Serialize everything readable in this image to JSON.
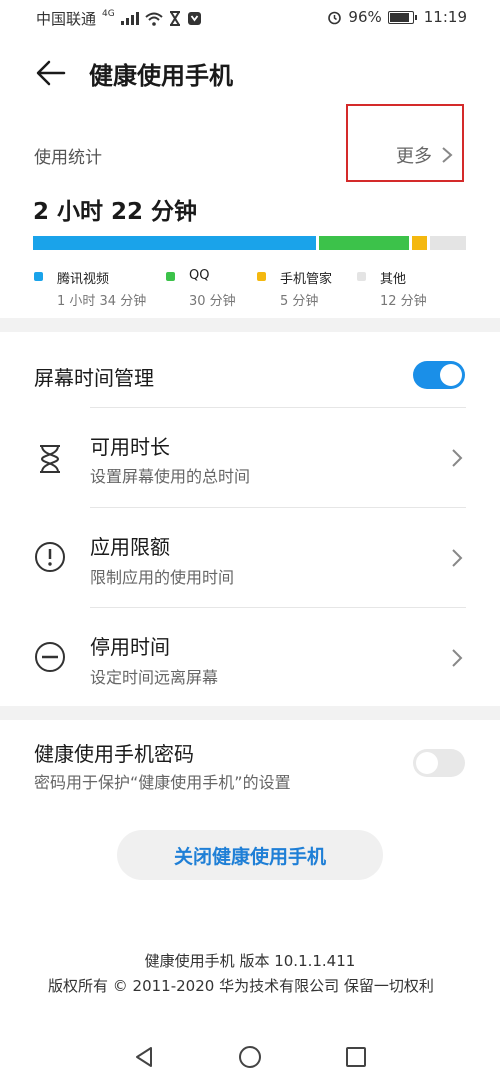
{
  "status_bar": {
    "carrier": "中国联通",
    "network": "4G",
    "battery_percent": "96%",
    "time": "11:19"
  },
  "header": {
    "title": "健康使用手机"
  },
  "usage": {
    "section_label": "使用统计",
    "more_label": "更多",
    "total_time": "2 小时 22 分钟",
    "apps": [
      {
        "name": "腾讯视频",
        "time": "1 小时 34 分钟",
        "minutes": 94,
        "color": "#1aa3ea"
      },
      {
        "name": "QQ",
        "time": "30 分钟",
        "minutes": 30,
        "color": "#3cc24a"
      },
      {
        "name": "手机管家",
        "time": "5 分钟",
        "minutes": 5,
        "color": "#f4b80f"
      },
      {
        "name": "其他",
        "time": "12 分钟",
        "minutes": 12,
        "color": "#e4e4e4"
      }
    ]
  },
  "screen_time": {
    "title": "屏幕时间管理",
    "enabled": true,
    "items": [
      {
        "title": "可用时长",
        "subtitle": "设置屏幕使用的总时间",
        "icon": "hourglass-icon"
      },
      {
        "title": "应用限额",
        "subtitle": "限制应用的使用时间",
        "icon": "exclamation-circle-icon"
      },
      {
        "title": "停用时间",
        "subtitle": "设定时间远离屏幕",
        "icon": "minus-circle-icon"
      }
    ]
  },
  "password": {
    "title": "健康使用手机密码",
    "subtitle": "密码用于保护“健康使用手机”的设置",
    "enabled": false
  },
  "close_button": "关闭健康使用手机",
  "footer": {
    "version": "健康使用手机 版本 10.1.1.411",
    "copyright": "版权所有 © 2011-2020 华为技术有限公司 保留一切权利"
  },
  "colors": {
    "accent": "#1a8fe8",
    "highlight_border": "#d42a2a",
    "button_text": "#1f7fd6"
  }
}
